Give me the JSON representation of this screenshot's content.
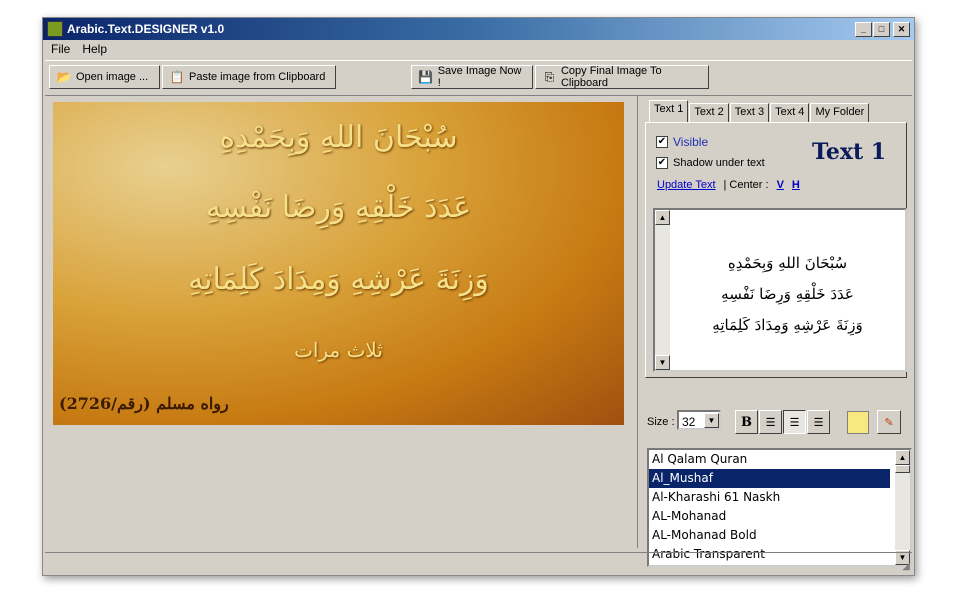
{
  "window": {
    "title": "Arabic.Text.DESIGNER  v1.0",
    "minimize": "_",
    "maximize": "□",
    "close": "✕"
  },
  "menu": [
    {
      "label": "File"
    },
    {
      "label": "Help"
    }
  ],
  "toolbar": {
    "open": "Open image ...",
    "paste": "Paste image from Clipboard",
    "save": "Save Image Now !",
    "copy": "Copy Final Image To Clipboard"
  },
  "canvas": {
    "lines": [
      "سُبْحَانَ اللهِ وَبِحَمْدِهِ",
      "عَدَدَ خَلْقِهِ وَرِضَا نَفْسِهِ",
      "وَزِنَةَ عَرْشِهِ وَمِدَادَ كَلِمَاتِهِ",
      "ثلاث مرات"
    ],
    "source": "رواه مسلم (رقم/2726)"
  },
  "tabs": [
    {
      "label": "Text 1"
    },
    {
      "label": "Text 2"
    },
    {
      "label": "Text 3"
    },
    {
      "label": "Text 4"
    },
    {
      "label": "My Folder"
    }
  ],
  "text_panel": {
    "visible_label": "Visible",
    "visible": true,
    "shadow_label": "Shadow under text",
    "shadow": true,
    "heading": "Text 1",
    "update": "Update Text",
    "center_label": "| Center :",
    "v": "V",
    "h": "H",
    "preview_lines": [
      "سُبْحَانَ اللهِ وَبِحَمْدِهِ",
      "عَدَدَ خَلْقِهِ وَرِضَا نَفْسِهِ",
      "وَزِنَةَ عَرْشِهِ وَمِدَادَ كَلِمَاتِهِ"
    ]
  },
  "format": {
    "size_label": "Size :",
    "size": "32",
    "bold": "B",
    "align_selected": "center",
    "color": "#f8e880"
  },
  "fonts": {
    "items": [
      "Al Qalam Quran",
      "Al_Mushaf",
      "Al-Kharashi 61 Naskh",
      "AL-Mohanad",
      "AL-Mohanad Bold",
      "Arabic Transparent"
    ],
    "selected": "Al_Mushaf"
  }
}
